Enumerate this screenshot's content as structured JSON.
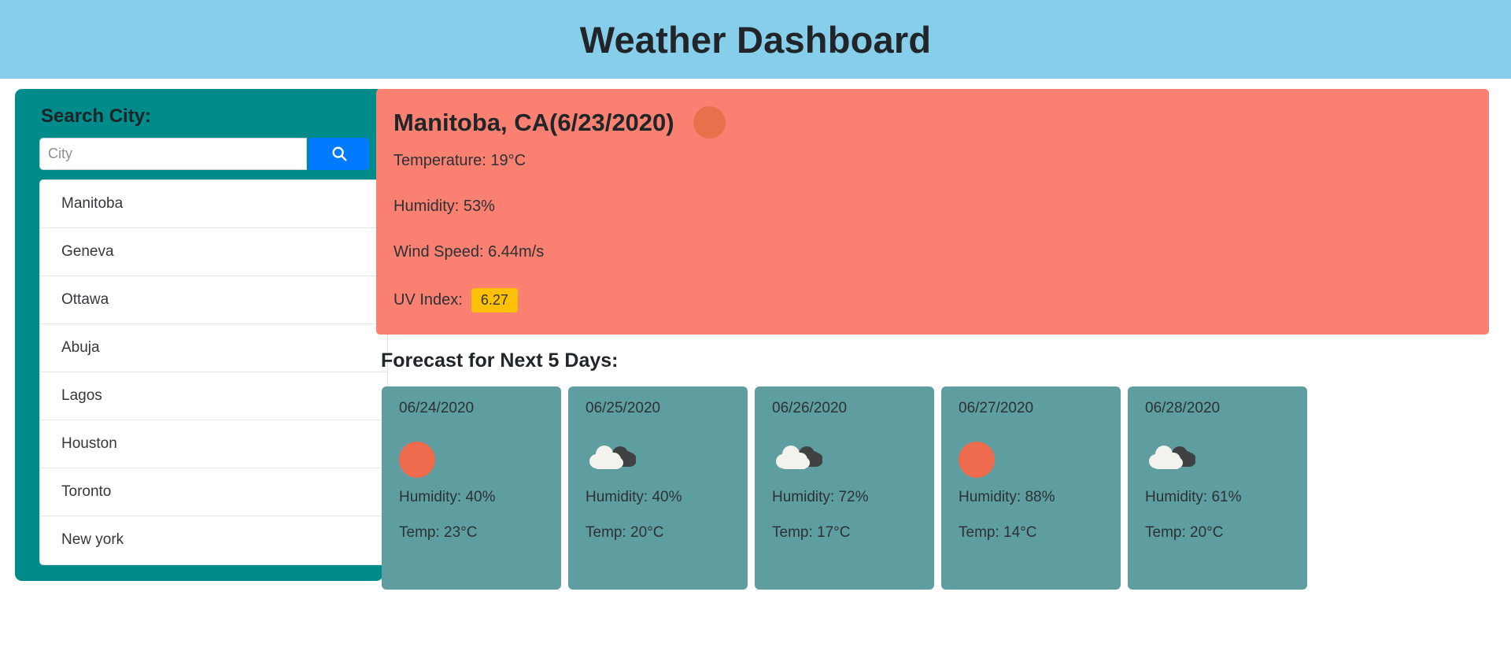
{
  "header": {
    "title": "Weather Dashboard",
    "background_color": "#87CEEB"
  },
  "sidebar": {
    "background_color": "#008B8B",
    "search_label": "Search City:",
    "search_input_value": "",
    "search_input_placeholder": "City",
    "search_button_icon": "search-icon",
    "search_button_color": "#007BFF",
    "cities": [
      {
        "name": "Manitoba"
      },
      {
        "name": "Geneva"
      },
      {
        "name": "Ottawa"
      },
      {
        "name": "Abuja"
      },
      {
        "name": "Lagos"
      },
      {
        "name": "Houston"
      },
      {
        "name": "Toronto"
      },
      {
        "name": "New york"
      }
    ]
  },
  "current": {
    "background_color": "#FA8072",
    "title": "Manitoba, CA(6/23/2020)",
    "icon": "sun-icon",
    "temperature": "Temperature: 19°C",
    "humidity": "Humidity: 53%",
    "wind_speed": "Wind Speed: 6.44m/s",
    "uv_label": "UV Index:",
    "uv_value": "6.27",
    "uv_badge_color": "#FFC107"
  },
  "forecast": {
    "title": "Forecast for Next 5 Days:",
    "card_color": "#5F9EA0",
    "days": [
      {
        "date": "06/24/2020",
        "icon": "sun-icon",
        "humidity": "Humidity: 40%",
        "temp": "Temp: 23°C"
      },
      {
        "date": "06/25/2020",
        "icon": "cloud-icon",
        "humidity": "Humidity: 40%",
        "temp": "Temp: 20°C"
      },
      {
        "date": "06/26/2020",
        "icon": "cloud-icon",
        "humidity": "Humidity: 72%",
        "temp": "Temp: 17°C"
      },
      {
        "date": "06/27/2020",
        "icon": "sun-icon",
        "humidity": "Humidity: 88%",
        "temp": "Temp: 14°C"
      },
      {
        "date": "06/28/2020",
        "icon": "cloud-icon",
        "humidity": "Humidity: 61%",
        "temp": "Temp: 20°C"
      }
    ]
  }
}
